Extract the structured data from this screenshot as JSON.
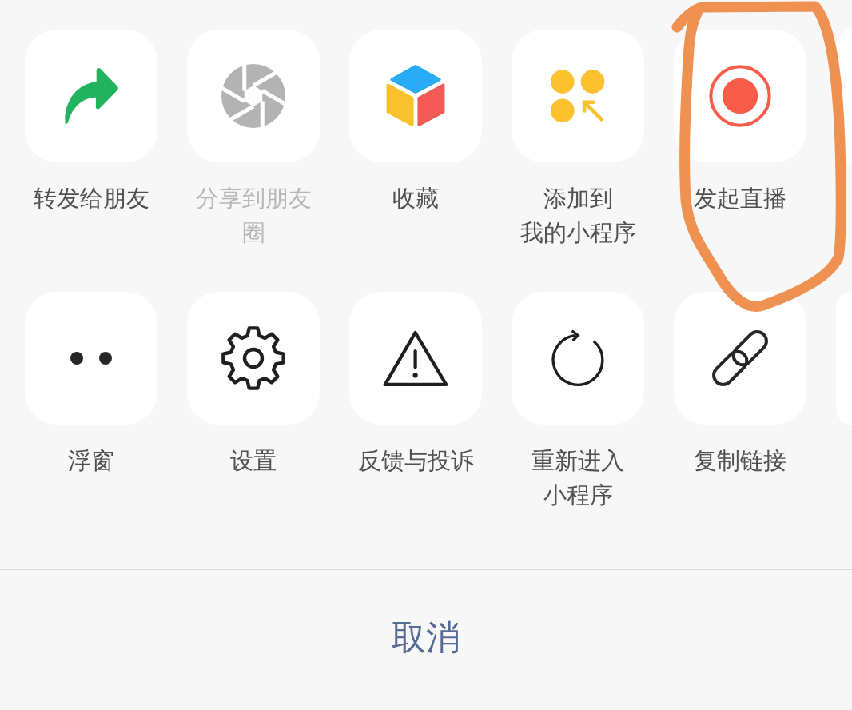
{
  "action_rows": [
    {
      "items": [
        {
          "kind": "forward",
          "label": [
            "转发给朋友"
          ],
          "disabled": false
        },
        {
          "kind": "moments",
          "label": [
            "分享到朋友圈"
          ],
          "disabled": true
        },
        {
          "kind": "favorite",
          "label": [
            "收藏"
          ],
          "disabled": false
        },
        {
          "kind": "pin",
          "label": [
            "添加到",
            "我的小程序"
          ],
          "disabled": false
        },
        {
          "kind": "live",
          "label": [
            "发起直播"
          ],
          "disabled": false
        }
      ],
      "overflow": true
    },
    {
      "items": [
        {
          "kind": "float",
          "label": [
            "浮窗"
          ],
          "disabled": false
        },
        {
          "kind": "settings",
          "label": [
            "设置"
          ],
          "disabled": false
        },
        {
          "kind": "complaint",
          "label": [
            "反馈与投诉"
          ],
          "disabled": false
        },
        {
          "kind": "restart",
          "label": [
            "重新进入",
            "小程序"
          ],
          "disabled": false
        },
        {
          "kind": "link",
          "label": [
            "复制链接"
          ],
          "disabled": false
        }
      ],
      "overflow": true
    }
  ],
  "cancel": {
    "label": "取消"
  },
  "annotation": {
    "kind": "loop"
  }
}
